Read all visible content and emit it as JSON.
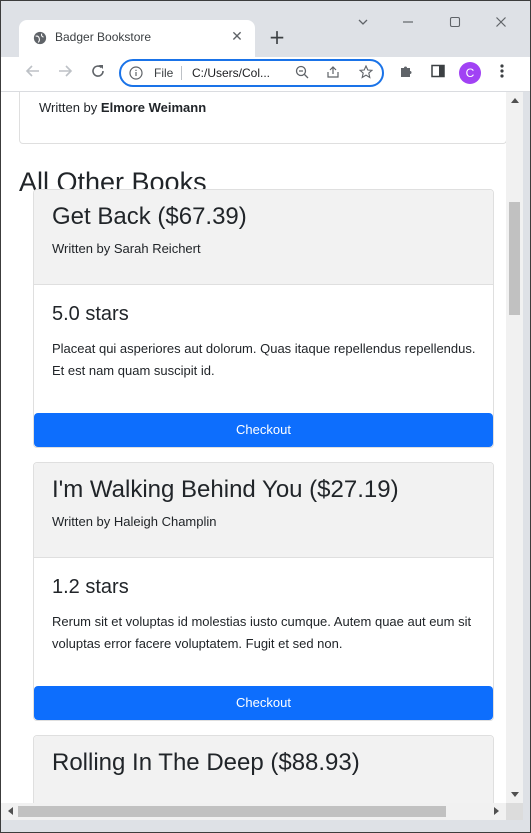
{
  "browser": {
    "tab_title": "Badger Bookstore",
    "new_tab": "+",
    "tab_close": "✕",
    "omnibox_scheme": "File",
    "omnibox_url": "C:/Users/Col...",
    "avatar_letter": "C",
    "avatar_color": "#a142f4",
    "accent_color": "#1a73e8"
  },
  "page": {
    "previous_author_prefix": "Written by",
    "previous_author_name": "Elmore Weimann",
    "section_title": "All Other Books",
    "checkout_color": "#0d6efd",
    "books": [
      {
        "title": "Get Back ($67.39)",
        "author": "Written by Sarah Reichert",
        "rating": "5.0 stars",
        "description": "Placeat qui asperiores aut dolorum. Quas itaque repellendus repellendus. Et est nam quam suscipit id.",
        "button": "Checkout"
      },
      {
        "title": "I'm Walking Behind You ($27.19)",
        "author": "Written by Haleigh Champlin",
        "rating": "1.2 stars",
        "description": "Rerum sit et voluptas id molestias iusto cumque. Autem quae aut eum sit voluptas error facere voluptatem. Fugit et sed non.",
        "button": "Checkout"
      },
      {
        "title": "Rolling In The Deep ($88.93)"
      }
    ]
  }
}
